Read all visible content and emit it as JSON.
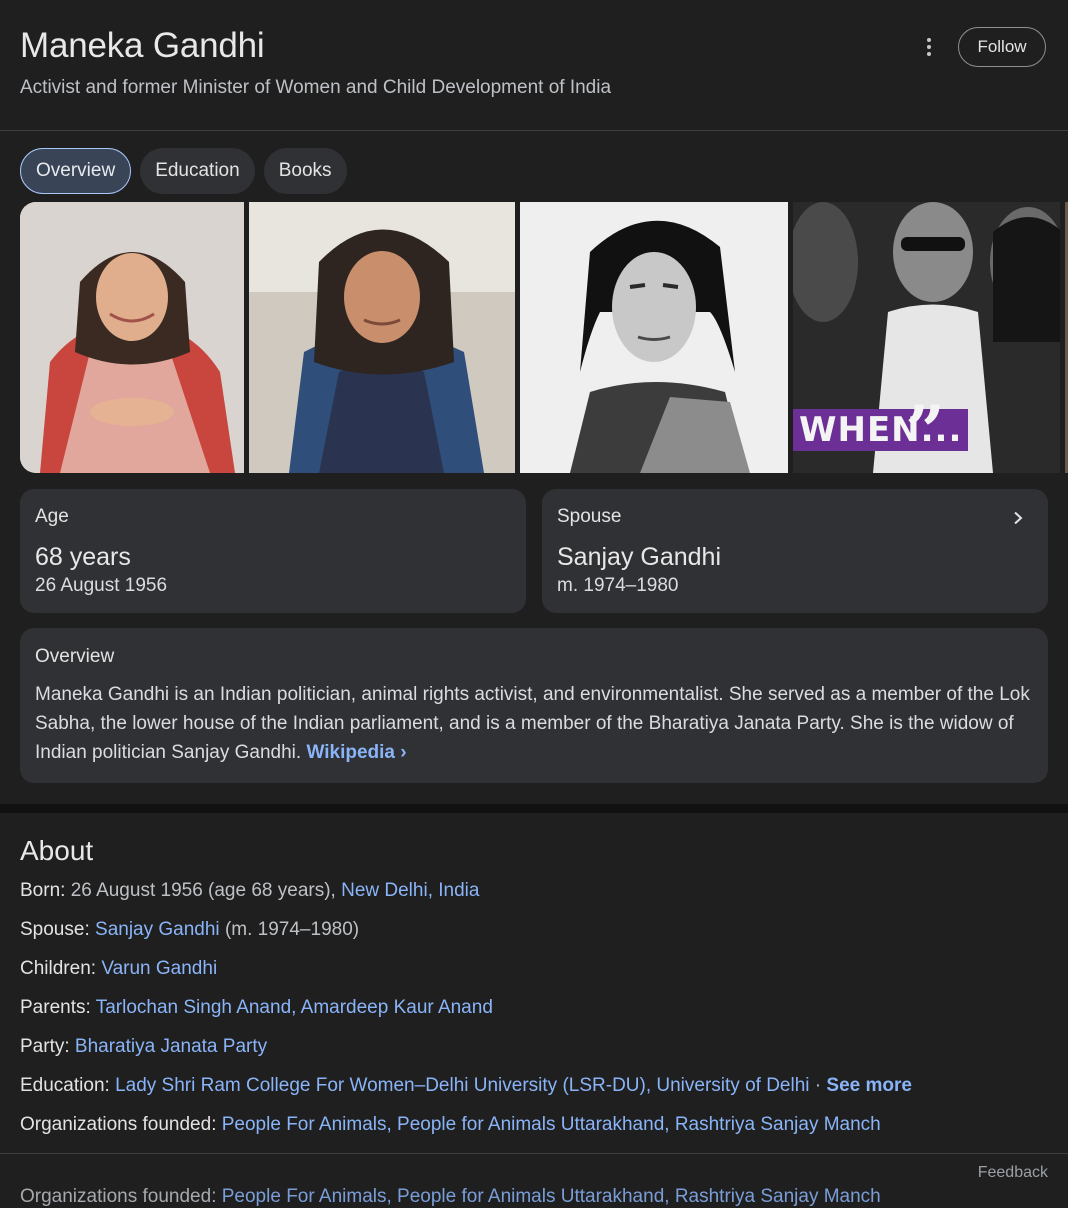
{
  "header": {
    "title": "Maneka Gandhi",
    "subtitle": "Activist and former Minister of Women and Child Development of India",
    "follow_label": "Follow"
  },
  "tabs": [
    {
      "label": "Overview",
      "active": true
    },
    {
      "label": "Education",
      "active": false
    },
    {
      "label": "Books",
      "active": false
    }
  ],
  "gallery": {
    "caption_text": "WHEN...",
    "caption_quote": "”"
  },
  "age_card": {
    "label": "Age",
    "value": "68 years",
    "sub": "26 August 1956"
  },
  "spouse_card": {
    "label": "Spouse",
    "value": "Sanjay Gandhi",
    "sub": "m. 1974–1980"
  },
  "overview": {
    "label": "Overview",
    "text": "Maneka Gandhi is an Indian politician, animal rights activist, and environmentalist. She served as a member of the Lok Sabha, the lower house of the Indian parliament, and is a member of the Bharatiya Janata Party. She is the widow of Indian politician Sanjay Gandhi. ",
    "source_link": "Wikipedia ›"
  },
  "about": {
    "title": "About",
    "born": {
      "key": "Born:",
      "text": " 26 August 1956 (age 68 years), ",
      "link": "New Delhi, India"
    },
    "spouse": {
      "key": "Spouse:",
      "link": "Sanjay Gandhi",
      "text": " (m. 1974–1980)"
    },
    "children": {
      "key": "Children:",
      "link": "Varun Gandhi"
    },
    "parents": {
      "key": "Parents:",
      "link": "Tarlochan Singh Anand, Amardeep Kaur Anand"
    },
    "party": {
      "key": "Party:",
      "link": "Bharatiya Janata Party"
    },
    "education": {
      "key": "Education:",
      "link": "Lady Shri Ram College For Women–Delhi University (LSR-DU), University of Delhi",
      "sep": " · ",
      "see_more": "See more"
    },
    "orgs": {
      "key": "Organizations founded:",
      "link": "People For Animals, People for Animals Uttarakhand, Rashtriya Sanjay Manch"
    }
  },
  "feedback_label": "Feedback",
  "colors": {
    "background": "#1f1f1f",
    "card": "#303134",
    "link": "#8ab4f8",
    "active_tab": "#394457"
  }
}
